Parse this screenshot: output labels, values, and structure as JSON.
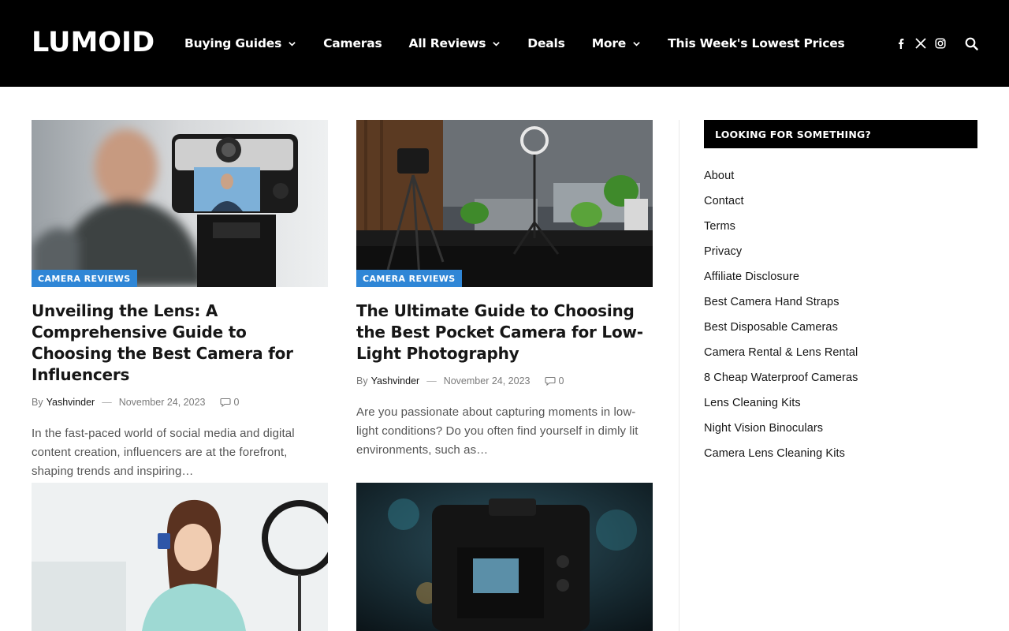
{
  "header": {
    "logo": "LUMOID",
    "nav": [
      {
        "label": "Buying Guides",
        "dropdown": true
      },
      {
        "label": "Cameras",
        "dropdown": false
      },
      {
        "label": "All Reviews",
        "dropdown": true
      },
      {
        "label": "Deals",
        "dropdown": false
      },
      {
        "label": "More",
        "dropdown": true
      },
      {
        "label": "This Week's Lowest Prices",
        "dropdown": false
      }
    ],
    "icons": [
      "facebook-icon",
      "x-icon",
      "instagram-icon",
      "search-icon"
    ]
  },
  "posts": [
    {
      "category": "CAMERA REVIEWS",
      "title": "Unveiling the Lens: A Comprehensive Guide to Choosing the Best Camera for Influencers",
      "by": "By",
      "author": "Yashvinder",
      "sep": "—",
      "date": "November 24, 2023",
      "comments": "0",
      "excerpt": "In the fast-paced world of social media and digital content creation, influencers are at the forefront, shaping trends and inspiring…"
    },
    {
      "category": "CAMERA REVIEWS",
      "title": "The Ultimate Guide to Choosing the Best Pocket Camera for Low-Light Photography",
      "by": "By",
      "author": "Yashvinder",
      "sep": "—",
      "date": "November 24, 2023",
      "comments": "0",
      "excerpt": "Are you passionate about capturing moments in low-light conditions? Do you often find yourself in dimly lit environments, such as…"
    }
  ],
  "sidebar": {
    "title": "LOOKING FOR SOMETHING?",
    "links": [
      "About",
      "Contact",
      "Terms",
      "Privacy",
      "Affiliate Disclosure",
      "Best Camera Hand Straps",
      "Best Disposable Cameras",
      "Camera Rental & Lens Rental",
      "8 Cheap Waterproof Cameras",
      "Lens Cleaning Kits",
      "Night Vision Binoculars",
      "Camera Lens Cleaning Kits"
    ]
  },
  "colors": {
    "header_bg": "#000000",
    "badge": "#2f86d6",
    "text": "#161616",
    "muted": "#7a7a7a"
  }
}
